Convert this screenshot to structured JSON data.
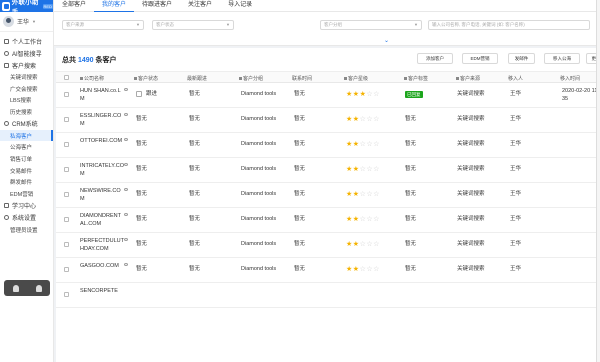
{
  "app": {
    "logo_text": "外联小助手",
    "logo_badge": "RED"
  },
  "user": {
    "name": "王华"
  },
  "sidebar": {
    "menu": [
      {
        "label": "个人工作台"
      },
      {
        "label": "AI智能搜寻"
      },
      {
        "label": "客户搜索"
      }
    ],
    "customer_search_items": [
      "关键词搜索",
      "广交会搜索",
      "LBS搜索",
      "历史搜索"
    ],
    "crm_label": "CRM系统",
    "crm_items": [
      "私海客户",
      "公海客户",
      "销售订单",
      "交易邮件",
      "群发邮件",
      "EDM营销"
    ],
    "study_label": "学习中心",
    "settings_label": "系统设置",
    "settings_items": [
      "管理员设置"
    ]
  },
  "tabs": [
    "全部客户",
    "我的客户",
    "待跟进客户",
    "关注客户",
    "导入记录"
  ],
  "active_tab": 1,
  "filters": {
    "source_placeholder": "客户来源",
    "status_placeholder": "客户状态",
    "group_placeholder": "客户分组",
    "search_placeholder": "输入公司名称, 客户电话, 关键词 (如: 客户名称)",
    "expand_icon": "chevron-down"
  },
  "toolbar": {
    "total_prefix": "总共",
    "total_count": "1490",
    "total_suffix": "条客户",
    "buttons": [
      "添加客户",
      "EDM营销",
      "发邮件",
      "移入公海",
      "更多"
    ]
  },
  "table": {
    "columns": [
      "公司名称",
      "客户状态",
      "最新跟进",
      "客户分组",
      "联系时间",
      "客户星级",
      "客户标签",
      "客户来源",
      "移入人",
      "移入时间"
    ],
    "rows": [
      {
        "company": "HUN SHAN.co.LM",
        "status": "跟进",
        "latest": "暂无",
        "group": "Diamond tools",
        "contact": "暂无",
        "stars": 3,
        "tag": "已回复",
        "source": "关键词搜索",
        "mover": "王华",
        "time": "2020-02-20 11:35"
      },
      {
        "company": "ESSLINGER.COM",
        "status": "暂无",
        "latest": "暂无",
        "group": "Diamond tools",
        "contact": "暂无",
        "stars": 2,
        "tag": "暂无",
        "source": "关键词搜索",
        "mover": "王华",
        "time": ""
      },
      {
        "company": "OTTOFREI.COM",
        "status": "暂无",
        "latest": "暂无",
        "group": "Diamond tools",
        "contact": "暂无",
        "stars": 2,
        "tag": "暂无",
        "source": "关键词搜索",
        "mover": "王华",
        "time": ""
      },
      {
        "company": "INTRICATELY.COM",
        "status": "暂无",
        "latest": "暂无",
        "group": "Diamond tools",
        "contact": "暂无",
        "stars": 2,
        "tag": "暂无",
        "source": "关键词搜索",
        "mover": "王华",
        "time": ""
      },
      {
        "company": "NEWSWIRE.COM",
        "status": "暂无",
        "latest": "暂无",
        "group": "Diamond tools",
        "contact": "暂无",
        "stars": 2,
        "tag": "暂无",
        "source": "关键词搜索",
        "mover": "王华",
        "time": ""
      },
      {
        "company": "DIAMONDRENTAL.COM",
        "status": "暂无",
        "latest": "暂无",
        "group": "Diamond tools",
        "contact": "暂无",
        "stars": 2,
        "tag": "暂无",
        "source": "关键词搜索",
        "mover": "王华",
        "time": ""
      },
      {
        "company": "PERFECTDULUTHDAY.COM",
        "status": "暂无",
        "latest": "暂无",
        "group": "Diamond tools",
        "contact": "暂无",
        "stars": 2,
        "tag": "暂无",
        "source": "关键词搜索",
        "mover": "王华",
        "time": ""
      },
      {
        "company": "GASGOO.COM",
        "status": "暂无",
        "latest": "暂无",
        "group": "Diamond tools",
        "contact": "暂无",
        "stars": 2,
        "tag": "暂无",
        "source": "关键词搜索",
        "mover": "王华",
        "time": ""
      },
      {
        "company": "SENCORPETE",
        "status": "",
        "latest": "",
        "group": "",
        "contact": "",
        "stars": 0,
        "tag": "",
        "source": "",
        "mover": "",
        "time": ""
      }
    ]
  },
  "colors": {
    "accent": "#1e73e6",
    "star": "#f5b301",
    "tag_green": "#1ca51c"
  }
}
